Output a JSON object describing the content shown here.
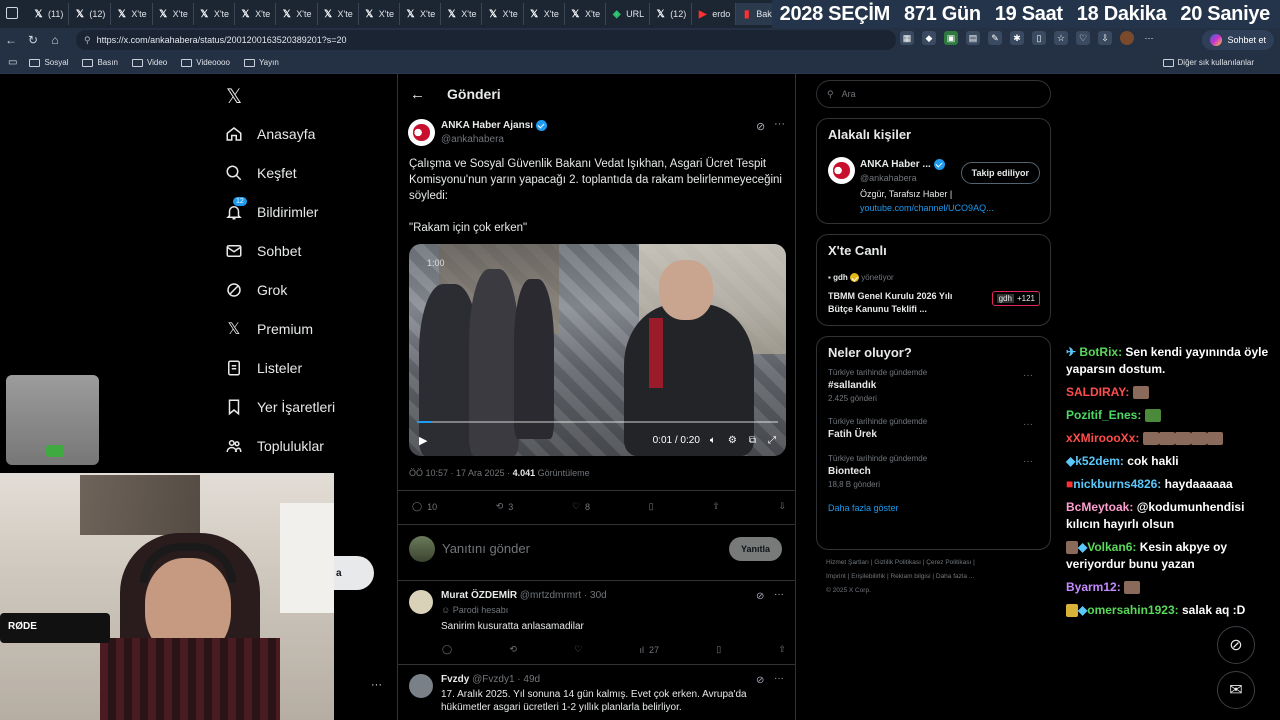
{
  "tabs": [
    {
      "label": "(11)"
    },
    {
      "label": "(12)"
    },
    {
      "label": "X'te"
    },
    {
      "label": "X'te"
    },
    {
      "label": "X'te"
    },
    {
      "label": "X'te"
    },
    {
      "label": "X'te"
    },
    {
      "label": "X'te"
    },
    {
      "label": "X'te"
    },
    {
      "label": "X'te"
    },
    {
      "label": "X'te"
    },
    {
      "label": "X'te"
    },
    {
      "label": "X'te"
    },
    {
      "label": "X'te"
    },
    {
      "label": "URL"
    },
    {
      "label": "(12)"
    },
    {
      "label": "erdo"
    },
    {
      "label": "Bak"
    }
  ],
  "countdown": {
    "title": "2028 SEÇİM",
    "days": "871 Gün",
    "hours": "19 Saat",
    "minutes": "18 Dakika",
    "seconds": "20 Saniye"
  },
  "browser": {
    "url": "https://x.com/ankahabera/status/2001200163520389201?s=20",
    "chat_button": "Sohbet et",
    "bookmarks": [
      "Sosyal",
      "Basın",
      "Video",
      "Videoooo",
      "Yayın"
    ],
    "other_bookmarks": "Diğer sık kullanılanlar"
  },
  "nav": {
    "items": [
      {
        "label": "Anasayfa",
        "icon": "home-icon"
      },
      {
        "label": "Keşfet",
        "icon": "search-icon"
      },
      {
        "label": "Bildirimler",
        "icon": "bell-icon",
        "badge": "12"
      },
      {
        "label": "Sohbet",
        "icon": "mail-icon"
      },
      {
        "label": "Grok",
        "icon": "grok-icon"
      },
      {
        "label": "Premium",
        "icon": "x-icon"
      },
      {
        "label": "Listeler",
        "icon": "list-icon"
      },
      {
        "label": "Yer İşaretleri",
        "icon": "bookmark-icon"
      },
      {
        "label": "Topluluklar",
        "icon": "people-icon"
      }
    ]
  },
  "post": {
    "header": "Gönderi",
    "author": "ANKA Haber Ajansı",
    "handle": "@ankahabera",
    "text": "Çalışma ve Sosyal Güvenlik Bakanı Vedat Işıkhan, Asgari Ücret Tespit Komisyonu'nun yarın yapacağı 2. toplantıda da rakam belirlenmeyeceğini söyledi:",
    "quote": "\"Rakam için çok erken\"",
    "video_time": "0:01 / 0:20",
    "video_badge": "1:00",
    "meta_time": "ÖÖ 10:57 · 17 Ara 2025 · ",
    "views": "4.041",
    "views_label": " Görüntüleme",
    "replies": "10",
    "reposts": "3",
    "likes": "8",
    "reply_placeholder": "Yanıtını gönder",
    "reply_button": "Yanıtla"
  },
  "replies": [
    {
      "name": "Murat ÖZDEMİR",
      "handle": "@mrtzdmrmrt",
      "time": "· 30d",
      "tag": "Parodi hesabı",
      "text": "Sanirim kusuratta anlasamadilar",
      "views": "27"
    },
    {
      "name": "Fvzdy",
      "handle": "@Fvzdy1",
      "time": "· 49d",
      "text": "17. Aralık 2025. Yıl sonuna 14 gün kalmış. Evet çok erken. Avrupa'da hükümetler asgari ücretleri 1-2 yıllık planlarla belirliyor."
    }
  ],
  "sidebar": {
    "search_placeholder": "Ara",
    "related_title": "Alakalı kişiler",
    "related": {
      "name": "ANKA Haber ...",
      "handle": "@ankahabera",
      "follow": "Takip ediliyor",
      "bio": "Özgür, Tarafsız Haber |",
      "link": "youtube.com/channel/UCO9AQ..."
    },
    "live_title": "X'te Canlı",
    "live": {
      "host": "gdh",
      "role": "yönetiyor",
      "title": "TBMM Genel Kurulu 2026 Yılı Bütçe Kanunu Teklifi ...",
      "count": "+121",
      "badge": "gdh"
    },
    "trends_title": "Neler oluyor?",
    "trends": [
      {
        "context": "Türkiye tarihinde gündemde",
        "name": "#sallandık",
        "count": "2.425 gönderi"
      },
      {
        "context": "Türkiye tarihinde gündemde",
        "name": "Fatih Ürek",
        "count": ""
      },
      {
        "context": "Türkiye tarihinde gündemde",
        "name": "Biontech",
        "count": "18,8 B gönderi"
      }
    ],
    "show_more": "Daha fazla göster",
    "footer": [
      "Hizmet Şartları",
      "Gizlilik Politikası",
      "Çerez Politikası",
      "Imprint",
      "Erişilebilirlik",
      "Reklam bilgisi",
      "Daha fazla ...",
      "© 2025 X Corp."
    ]
  },
  "chat": [
    {
      "user": "BotRix:",
      "color": "#5ad85a",
      "text": "Sen kendi yayınında öyle yaparsın dostum."
    },
    {
      "user": "SALDIRAY:",
      "color": "#ff4d4d",
      "text": ""
    },
    {
      "user": "Pozitif_Enes:",
      "color": "#4cd964",
      "text": ""
    },
    {
      "user": "xXMiroooXx:",
      "color": "#ff4d4d",
      "text": ""
    },
    {
      "user": "k52dem:",
      "color": "#5ac8fa",
      "text": "cok hakli"
    },
    {
      "user": "nickburns4826:",
      "color": "#5ac8fa",
      "text": "haydaaaaaa"
    },
    {
      "user": "BcMeytoak:",
      "color": "#ff9fd1",
      "text": "@kodumunhendisi kılıcın hayırlı olsun"
    },
    {
      "user": "Volkan6:",
      "color": "#5ad85a",
      "text": "Kesin akpye oy veriyordur bunu yazan"
    },
    {
      "user": "Byarm12:",
      "color": "#c48bff",
      "text": ""
    },
    {
      "user": "omersahin1923:",
      "color": "#5ad85a",
      "text": "salak aq :D"
    }
  ],
  "colors": {
    "accent": "#1d9bf0",
    "bg": "#000000",
    "muted": "#71767b",
    "border": "#2f3336"
  }
}
